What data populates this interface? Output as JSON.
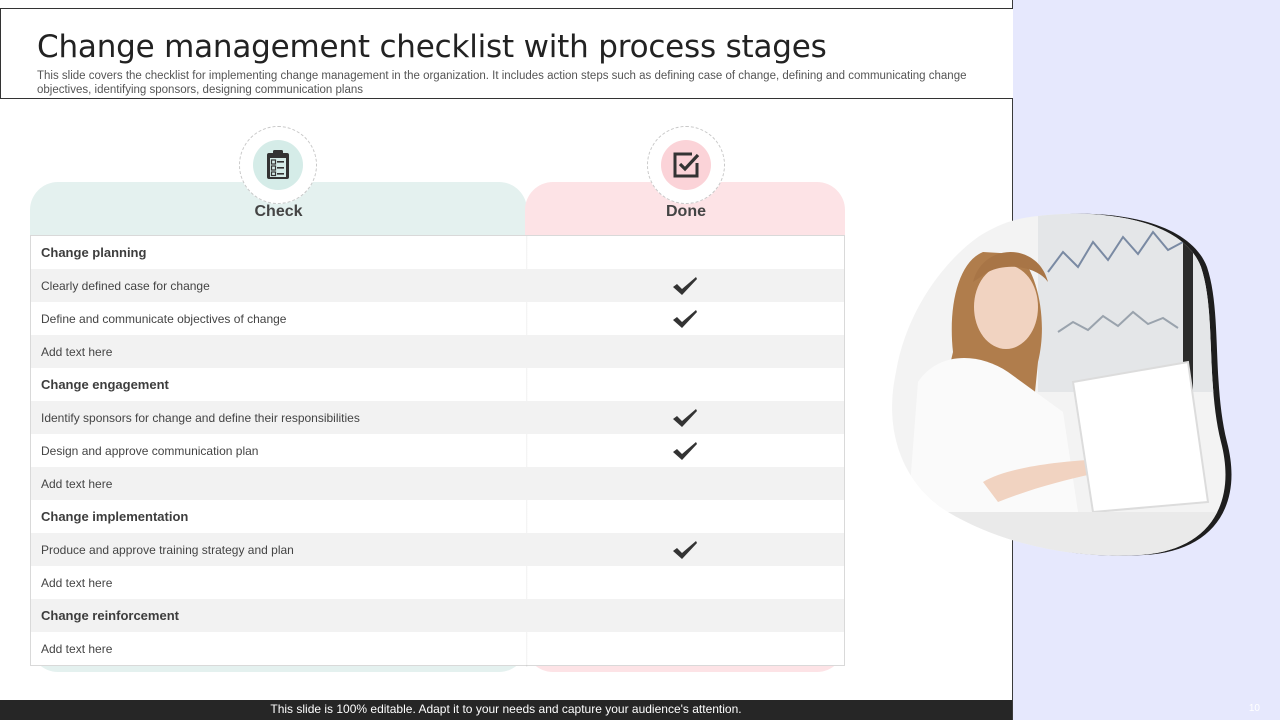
{
  "slide": {
    "title": "Change management checklist with process stages",
    "subtitle": "This slide covers the checklist for implementing change management in the organization. It includes action steps such as defining case of change, defining and communicating change objectives, identifying sponsors, designing communication plans",
    "slide_number": "10",
    "footer": "This slide is 100% editable. Adapt it to your needs and capture your audience's attention."
  },
  "columns": {
    "check": {
      "label": "Check",
      "icon": "clipboard-checklist-icon",
      "color": "#d5ece8"
    },
    "done": {
      "label": "Done",
      "icon": "checkbox-icon",
      "color": "#fbd3d8"
    }
  },
  "rows": [
    {
      "text": "Change planning",
      "section": true,
      "done": false
    },
    {
      "text": "Clearly defined case for change",
      "section": false,
      "done": true
    },
    {
      "text": "Define and communicate objectives of change",
      "section": false,
      "done": true
    },
    {
      "text": "Add text here",
      "section": false,
      "done": false
    },
    {
      "text": "Change engagement",
      "section": true,
      "done": false
    },
    {
      "text": "Identify sponsors for change and define their responsibilities",
      "section": false,
      "done": true
    },
    {
      "text": "Design and approve communication plan",
      "section": false,
      "done": true
    },
    {
      "text": "Add text here",
      "section": false,
      "done": false
    },
    {
      "text": "Change implementation",
      "section": true,
      "done": false
    },
    {
      "text": "Produce and approve training strategy and plan",
      "section": false,
      "done": true
    },
    {
      "text": "Add text here",
      "section": false,
      "done": false
    },
    {
      "text": "Change reinforcement",
      "section": true,
      "done": false
    },
    {
      "text": "Add text here",
      "section": false,
      "done": false
    }
  ],
  "colors": {
    "side_panel": "#e6e8fd",
    "footer_bar": "#262626",
    "tick": "#333333"
  }
}
